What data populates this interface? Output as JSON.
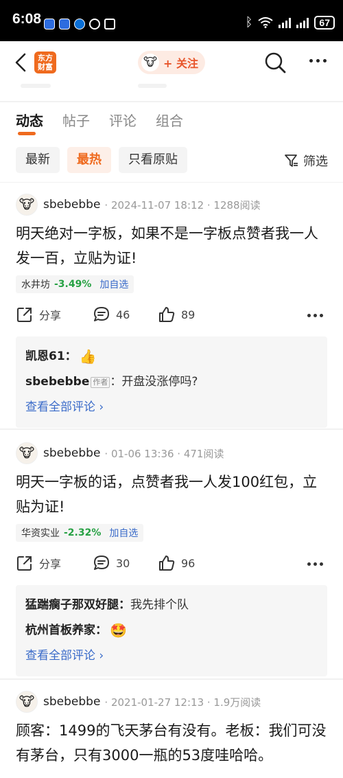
{
  "status_bar": {
    "time": "6:08",
    "battery": "67"
  },
  "nav": {
    "logo_text": "东方财富",
    "follow_label": "+ 关注"
  },
  "tabs": [
    "动态",
    "帖子",
    "评论",
    "组合"
  ],
  "filters": [
    "最新",
    "最热",
    "只看原贴"
  ],
  "filter_button": "筛选",
  "posts": [
    {
      "author": "sbebebbe",
      "meta": "· 2024-11-07 18:12 · 1288阅读",
      "text": "明天绝对一字板，如果不是一字板点赞者我一人发一百，立贴为证!",
      "stock": {
        "name": "水井坊",
        "change": "-3.49%",
        "add": "加自选"
      },
      "share_label": "分享",
      "comments_count": "46",
      "likes_count": "89",
      "comments": [
        {
          "user": "凯恩61：",
          "text": "",
          "emoji": "👍"
        },
        {
          "user": "sbebebbe",
          "tag": "作者",
          "text": "：开盘没涨停吗?"
        }
      ],
      "view_all": "查看全部评论 ›"
    },
    {
      "author": "sbebebbe",
      "meta": "· 01-06 13:36 · 471阅读",
      "text": "明天一字板的话，点赞者我一人发100红包，立贴为证!",
      "stock": {
        "name": "华资实业",
        "change": "-2.32%",
        "add": "加自选"
      },
      "share_label": "分享",
      "comments_count": "30",
      "likes_count": "96",
      "comments": [
        {
          "user": "猛踹瘸子那双好腿：",
          "text": "我先排个队"
        },
        {
          "user": "杭州首板养家：",
          "text": "",
          "emoji": "🤩"
        }
      ],
      "view_all": "查看全部评论 ›"
    },
    {
      "author": "sbebebbe",
      "meta": "· 2021-01-27 12:13 · 1.9万阅读",
      "text": "顾客：1499的飞天茅台有没有。老板：我们可没有茅台，只有3000一瓶的53度哇哈哈。"
    }
  ],
  "icons": {
    "avatar": "cow-avatar-icon",
    "share": "share-icon",
    "comment": "comment-icon",
    "like": "thumbs-up-icon"
  },
  "colors": {
    "accent": "#ef6a1e",
    "down": "#27a144",
    "link": "#3a6bc9"
  }
}
